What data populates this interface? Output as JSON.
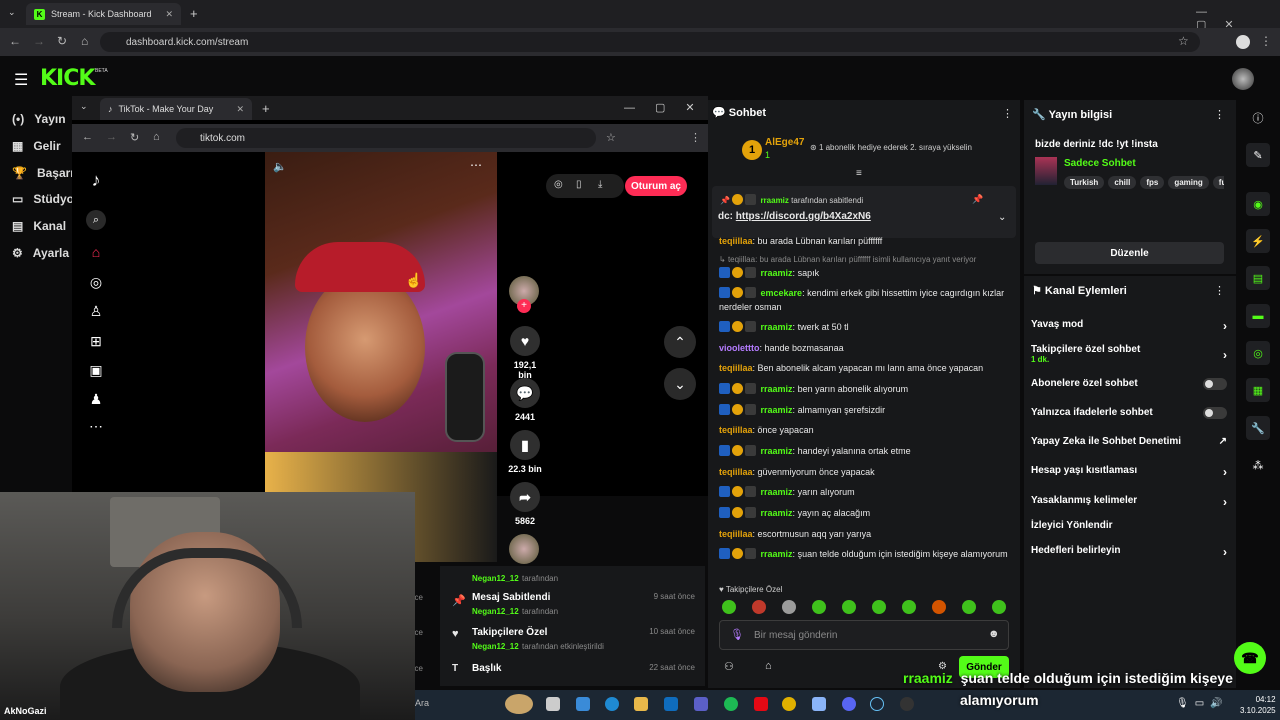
{
  "browser": {
    "tab_title": "Stream - Kick Dashboard",
    "url": "dashboard.kick.com/stream"
  },
  "kick": {
    "logo": "KICK",
    "beta": "BETA",
    "sidebar": [
      {
        "icon": "broadcast-icon",
        "label": "Yayın"
      },
      {
        "icon": "income-icon",
        "label": "Gelir"
      },
      {
        "icon": "trophy-icon",
        "label": "Başarıla"
      },
      {
        "icon": "studio-icon",
        "label": "Stüdyo"
      },
      {
        "icon": "channel-icon",
        "label": "Kanal"
      },
      {
        "icon": "settings-icon",
        "label": "Ayarla"
      }
    ]
  },
  "tiktok": {
    "tab_title": "TikTok - Make Your Day",
    "url": "tiktok.com",
    "login_button": "Oturum aç",
    "likes": "192,1 bin",
    "comments": "2441",
    "saves": "22.3 bin",
    "shares": "5862"
  },
  "activity": [
    {
      "title": "",
      "user": "Negan12_12",
      "suffix": "tarafından",
      "time": ""
    },
    {
      "title": "Mesaj Sabitlendi",
      "user": "Negan12_12",
      "suffix": "tarafından",
      "time": "9 saat önce"
    },
    {
      "title": "Takipçilere Özel",
      "user": "Negan12_12",
      "suffix": "tarafından etkinleştirildi",
      "time": "10 saat önce"
    },
    {
      "title": "Başlık",
      "user": "",
      "suffix": "",
      "time": "22 saat önce"
    }
  ],
  "activity_left_labels": [
    "öce",
    "öce",
    "öce"
  ],
  "chat": {
    "header": "Sohbet",
    "top_gifter": "AlEge47",
    "top_gifter_count": "1",
    "gift_notice": "1 abonelik hediye ederek 2. sıraya yükselin",
    "pinned_by_user": "rraamiz",
    "pinned_by_suffix": "tarafından sabitlendi",
    "pinned_prefix": "dc:",
    "pinned_link": "https://discord.gg/b4Xa2xN6",
    "messages": [
      {
        "user": "teqiillaa",
        "color": "#e3a20a",
        "text": "bu arada Lübnan karıları püffffff",
        "badges": false
      },
      {
        "user": "",
        "color": "#888888",
        "text": "teqiillaa: bu arada Lübnan karıları püffffff isimli kullanıcıya yanıt veriyor",
        "badges": false,
        "reply": true
      },
      {
        "user": "rraamiz",
        "color": "#53fc18",
        "text": "sapık",
        "badges": true
      },
      {
        "user": "emcekare",
        "color": "#53fc18",
        "text": "kendimi erkek gibi hissettim iyice cagırdıgın kızlar nerdeler osman",
        "badges": true
      },
      {
        "user": "rraamiz",
        "color": "#53fc18",
        "text": "twerk at 50 tl",
        "badges": true
      },
      {
        "user": "vioolettto",
        "color": "#b57cff",
        "text": "hande bozmasanaa",
        "badges": false
      },
      {
        "user": "teqiillaa",
        "color": "#e3a20a",
        "text": "Ben abonelik alcam yapacan mı lann ama önce yapacan",
        "badges": false
      },
      {
        "user": "rraamiz",
        "color": "#53fc18",
        "text": "ben yarın abonelik alıyorum",
        "badges": true
      },
      {
        "user": "rraamiz",
        "color": "#53fc18",
        "text": "almamıyan şerefsizdir",
        "badges": true
      },
      {
        "user": "teqiillaa",
        "color": "#e3a20a",
        "text": "önce yapacan",
        "badges": false
      },
      {
        "user": "rraamiz",
        "color": "#53fc18",
        "text": "handeyi yalanına ortak etme",
        "badges": true
      },
      {
        "user": "teqiillaa",
        "color": "#e3a20a",
        "text": "güvenmiyorum önce yapacak",
        "badges": false
      },
      {
        "user": "rraamiz",
        "color": "#53fc18",
        "text": "yarın alıyorum",
        "badges": true
      },
      {
        "user": "rraamiz",
        "color": "#53fc18",
        "text": "yayın aç alacağım",
        "badges": true
      },
      {
        "user": "teqiillaa",
        "color": "#e3a20a",
        "text": "escortmusun aqq yarı yarıya",
        "badges": false
      },
      {
        "user": "rraamiz",
        "color": "#53fc18",
        "text": "şuan telde olduğum için istediğim kişeye alamıyorum",
        "badges": true
      }
    ],
    "followers_only_label": "Takipçilere Özel",
    "input_placeholder": "Bir mesaj gönderin",
    "send_button": "Gönder"
  },
  "stream_info": {
    "header": "Yayın bilgisi",
    "title": "bizde deriniz !dc !yt !insta",
    "category": "Sadece Sohbet",
    "tags": [
      "Turkish",
      "chill",
      "fps",
      "gaming",
      "fu"
    ],
    "edit_button": "Düzenle"
  },
  "channel_actions": {
    "header": "Kanal Eylemleri",
    "items": [
      {
        "label": "Yavaş mod",
        "kind": "chevron"
      },
      {
        "label": "Takipçilere özel sohbet",
        "sub": "1 dk.",
        "kind": "chevron"
      },
      {
        "label": "Abonelere özel sohbet",
        "kind": "toggle"
      },
      {
        "label": "Yalnızca ifadelerle sohbet",
        "kind": "toggle"
      },
      {
        "label": "Yapay Zeka ile Sohbet Denetimi",
        "kind": "external"
      },
      {
        "label": "Hesap yaşı kısıtlaması",
        "kind": "chevron"
      },
      {
        "label": "Yasaklanmış kelimeler",
        "kind": "chevron"
      },
      {
        "label": "İzleyici Yönlendir",
        "kind": "none"
      },
      {
        "label": "Hedefleri belirleyin",
        "kind": "chevron"
      }
    ]
  },
  "overlay_caption": {
    "user": "rraamiz",
    "line1": "şuan telde olduğum için istediğim kişeye",
    "line2": "alamıyorum"
  },
  "taskbar": {
    "search": "Ara",
    "time": "04:12",
    "date": "3.10.2025"
  },
  "watermark": "AkNoGazi"
}
